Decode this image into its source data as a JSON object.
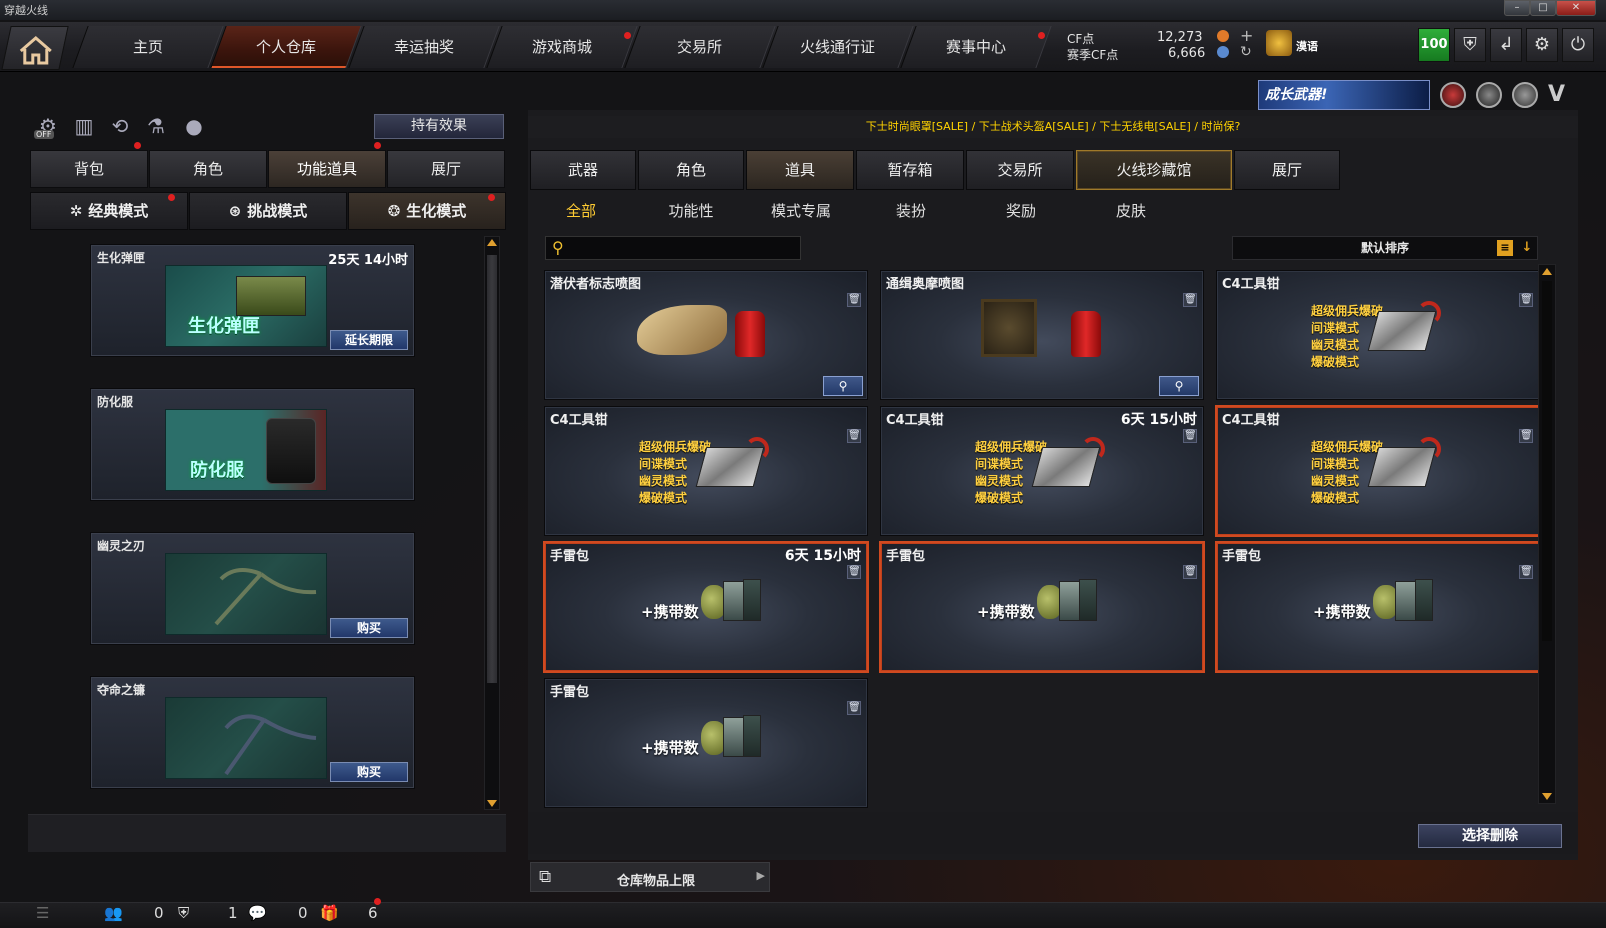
{
  "window": {
    "title": "穿越火线"
  },
  "nav": {
    "home_icon": "home-icon",
    "tabs": [
      {
        "label": "主页",
        "active": false,
        "badge": false
      },
      {
        "label": "个人仓库",
        "active": true,
        "badge": false
      },
      {
        "label": "幸运抽奖",
        "active": false,
        "badge": false
      },
      {
        "label": "游戏商城",
        "active": false,
        "badge": true
      },
      {
        "label": "交易所",
        "active": false,
        "badge": false
      },
      {
        "label": "火线通行证",
        "active": false,
        "badge": false
      },
      {
        "label": "赛事中心",
        "active": false,
        "badge": true
      }
    ]
  },
  "currency": {
    "cf_label": "CF点",
    "cf_value": "12,273",
    "season_label": "赛季CF点",
    "season_value": "6,666",
    "username": "漠语",
    "level_badge": "100"
  },
  "left": {
    "hold_effect_label": "持有效果",
    "off_label": "OFF",
    "tabs": [
      "背包",
      "角色",
      "功能道具",
      "展厅"
    ],
    "active_tab": 2,
    "modes": [
      "经典模式",
      "挑战模式",
      "生化模式"
    ],
    "active_mode": 2,
    "items": [
      {
        "name": "生化弹匣",
        "time": "25天 14小时",
        "button": "延长期限",
        "image_text": "生化弹匣"
      },
      {
        "name": "防化服",
        "time": "",
        "button": "",
        "image_text": "防化服"
      },
      {
        "name": "幽灵之刃",
        "time": "",
        "button": "购买",
        "image_text": ""
      },
      {
        "name": "夺命之镰",
        "time": "",
        "button": "购买",
        "image_text": ""
      }
    ]
  },
  "right": {
    "banner": "成长武器!",
    "ticker": "下士时尚眼罩[SALE] / 下士战术头盔A[SALE] / 下士无线电[SALE] / 时尚保?",
    "tabs": [
      "武器",
      "角色",
      "道具",
      "暂存箱",
      "交易所",
      "火线珍藏馆",
      "展厅"
    ],
    "active_tab": 2,
    "gold_tab": 5,
    "subtabs": [
      "全部",
      "功能性",
      "模式专属",
      "装扮",
      "奖励",
      "皮肤"
    ],
    "active_subtab": 0,
    "sort_label": "默认排序",
    "items": [
      {
        "name": "潜伏者标志喷图",
        "time": "",
        "type": "spray-claw",
        "selected": false,
        "search": true
      },
      {
        "name": "通缉奥摩喷图",
        "time": "",
        "type": "spray-photo",
        "selected": false,
        "search": true
      },
      {
        "name": "C4工具钳",
        "time": "",
        "type": "c4",
        "selected": false,
        "search": false
      },
      {
        "name": "C4工具钳",
        "time": "",
        "type": "c4",
        "selected": false,
        "search": false
      },
      {
        "name": "C4工具钳",
        "time": "6天 15小时",
        "type": "c4",
        "selected": false,
        "search": false
      },
      {
        "name": "C4工具钳",
        "time": "",
        "type": "c4",
        "selected": true,
        "search": false
      },
      {
        "name": "手雷包",
        "time": "6天 15小时",
        "type": "grenade",
        "selected": true,
        "search": false
      },
      {
        "name": "手雷包",
        "time": "",
        "type": "grenade",
        "selected": true,
        "search": false
      },
      {
        "name": "手雷包",
        "time": "",
        "type": "grenade",
        "selected": true,
        "search": false
      },
      {
        "name": "手雷包",
        "time": "",
        "type": "grenade",
        "selected": false,
        "search": false
      }
    ],
    "c4_modes": [
      "超级佣兵爆破",
      "间谍模式",
      "幽灵模式",
      "爆破模式"
    ],
    "grenade_text": "+携带数",
    "delete_button": "选择删除",
    "limit_label": "仓库物品上限"
  },
  "status": {
    "count1": "0",
    "count2": "1",
    "count3": "0",
    "count4": "6"
  }
}
